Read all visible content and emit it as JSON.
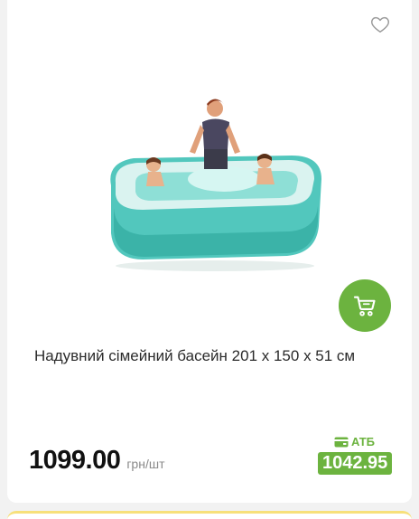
{
  "product": {
    "title": "Надувний сімейний басейн 201 x 150 x 51 см",
    "price": "1099.00",
    "unit": "грн/шт",
    "promo_label": "АТБ",
    "promo_price": "1042.95"
  },
  "icons": {
    "favorite": "heart-outline-icon",
    "cart": "shopping-cart-icon",
    "card": "card-icon"
  },
  "colors": {
    "accent_green": "#6cb33f",
    "price_text": "#111111",
    "unit_text": "#8a8a8a"
  }
}
